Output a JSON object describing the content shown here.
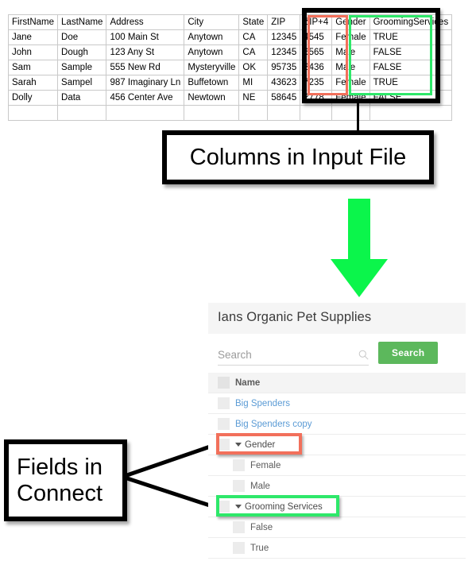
{
  "spreadsheet": {
    "columns": [
      "FirstName",
      "LastName",
      "Address",
      "City",
      "State",
      "ZIP",
      "ZIP+4",
      "Gender",
      "GroomingServices"
    ],
    "rows": [
      [
        "Jane",
        "Doe",
        "100 Main St",
        "Anytown",
        "CA",
        "12345",
        "4545",
        "Female",
        "TRUE"
      ],
      [
        "John",
        "Dough",
        "123 Any St",
        "Anytown",
        "CA",
        "12345",
        "6565",
        "Male",
        "FALSE"
      ],
      [
        "Sam",
        "Sample",
        "555 New Rd",
        "Mysteryville",
        "OK",
        "95735",
        "2436",
        "Male",
        "FALSE"
      ],
      [
        "Sarah",
        "Sampel",
        "987 Imaginary Ln",
        "Buffetown",
        "MI",
        "43623",
        "7235",
        "Female",
        "TRUE"
      ],
      [
        "Dolly",
        "Data",
        "456 Center Ave",
        "Newtown",
        "NE",
        "58645",
        "2778",
        "Female",
        "FALSE"
      ]
    ],
    "highlight_red_column": "Gender",
    "highlight_green_column": "GroomingServices"
  },
  "callouts": {
    "columns_in_input_file": "Columns in Input File",
    "fields_in_connect_line1": "Fields in",
    "fields_in_connect_line2": "Connect"
  },
  "arrow": {
    "name": "down-arrow",
    "color": "#0bf54b"
  },
  "app": {
    "title": "Ians Organic Pet Supplies",
    "search": {
      "placeholder": "Search",
      "value": "",
      "button_label": "Search",
      "icon": "search-icon"
    },
    "list": {
      "header": "Name",
      "items": [
        {
          "label": "Big Spenders",
          "type": "link",
          "indent": 0,
          "expanded": false
        },
        {
          "label": "Big Spenders copy",
          "type": "link",
          "indent": 0,
          "expanded": false
        },
        {
          "label": "Gender",
          "type": "group",
          "indent": 0,
          "expanded": true,
          "highlight": "#f2705b"
        },
        {
          "label": "Female",
          "type": "value",
          "indent": 1,
          "expanded": false
        },
        {
          "label": "Male",
          "type": "value",
          "indent": 1,
          "expanded": false
        },
        {
          "label": "Grooming Services",
          "type": "group",
          "indent": 0,
          "expanded": true,
          "highlight": "#2ee86a"
        },
        {
          "label": "False",
          "type": "value",
          "indent": 1,
          "expanded": false
        },
        {
          "label": "True",
          "type": "value",
          "indent": 1,
          "expanded": false
        }
      ]
    }
  },
  "colors": {
    "accent_green_button": "#5cb85c",
    "arrow_green": "#0bf54b",
    "highlight_red": "#f2705b",
    "highlight_green": "#2ee86a",
    "link_blue": "#5b9bd5"
  }
}
